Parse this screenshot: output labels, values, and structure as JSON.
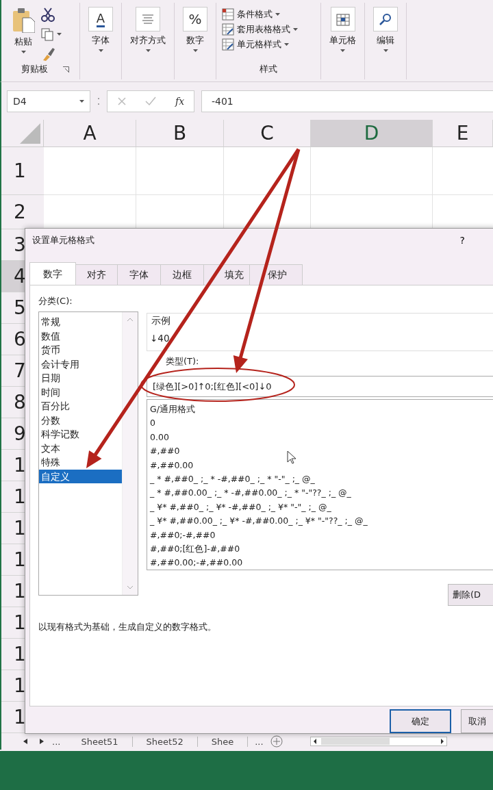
{
  "ribbon": {
    "groups": [
      {
        "kind": "clipboard",
        "label": "剪贴板",
        "paste": "粘贴"
      },
      {
        "kind": "font",
        "icon_text": "A",
        "label": "字体"
      },
      {
        "kind": "align",
        "label": "对齐方式"
      },
      {
        "kind": "number",
        "icon_text": "%",
        "label": "数字"
      },
      {
        "kind": "styles",
        "label": "样式",
        "items": [
          "条件格式",
          "套用表格格式",
          "单元格样式"
        ]
      },
      {
        "kind": "cells",
        "label": "单元格"
      },
      {
        "kind": "edit",
        "label": "编辑"
      }
    ]
  },
  "formula_bar": {
    "name_box": "D4",
    "fx": "fx",
    "value": "-401"
  },
  "grid": {
    "columns": [
      {
        "label": "A",
        "selected": false
      },
      {
        "label": "B",
        "selected": false
      },
      {
        "label": "C",
        "selected": false
      },
      {
        "label": "D",
        "selected": true
      },
      {
        "label": "E",
        "selected": false
      }
    ],
    "rows": [
      {
        "label": "1",
        "selected": false
      },
      {
        "label": "2",
        "selected": false
      },
      {
        "label": "3",
        "selected": false
      },
      {
        "label": "4",
        "selected": true
      },
      {
        "label": "5",
        "selected": false
      },
      {
        "label": "6",
        "selected": false
      },
      {
        "label": "7",
        "selected": false
      },
      {
        "label": "8",
        "selected": false
      },
      {
        "label": "9",
        "selected": false
      },
      {
        "label": "1",
        "selected": false
      },
      {
        "label": "1",
        "selected": false
      },
      {
        "label": "1",
        "selected": false
      },
      {
        "label": "1",
        "selected": false
      },
      {
        "label": "1",
        "selected": false
      },
      {
        "label": "1",
        "selected": false
      },
      {
        "label": "1",
        "selected": false
      },
      {
        "label": "1",
        "selected": false
      },
      {
        "label": "1",
        "selected": false
      }
    ]
  },
  "dialog": {
    "title": "设置单元格格式",
    "help": "?",
    "tabs": [
      {
        "label": "数字",
        "selected": true
      },
      {
        "label": "对齐",
        "selected": false
      },
      {
        "label": "字体",
        "selected": false
      },
      {
        "label": "边框",
        "selected": false
      },
      {
        "label": "填充",
        "selected": false
      },
      {
        "label": "保护",
        "selected": false
      }
    ],
    "category": {
      "label": "分类(C):",
      "items": [
        {
          "label": "常规",
          "selected": false
        },
        {
          "label": "数值",
          "selected": false
        },
        {
          "label": "货币",
          "selected": false
        },
        {
          "label": "会计专用",
          "selected": false
        },
        {
          "label": "日期",
          "selected": false
        },
        {
          "label": "时间",
          "selected": false
        },
        {
          "label": "百分比",
          "selected": false
        },
        {
          "label": "分数",
          "selected": false
        },
        {
          "label": "科学记数",
          "selected": false
        },
        {
          "label": "文本",
          "selected": false
        },
        {
          "label": "特殊",
          "selected": false
        },
        {
          "label": "自定义",
          "selected": true
        }
      ]
    },
    "sample": {
      "label": "示例",
      "value": "↓40"
    },
    "type": {
      "label": "类型(T):",
      "value": "[绿色][>0]↑0;[红色][<0]↓0"
    },
    "formats": [
      "G/通用格式",
      "0",
      "0.00",
      "#,##0",
      "#,##0.00",
      "_ * #,##0_ ;_ * -#,##0_ ;_ * \"-\"_ ;_ @_",
      "_ * #,##0.00_ ;_ * -#,##0.00_ ;_ * \"-\"??_ ;_ @_",
      "_ ¥* #,##0_ ;_ ¥* -#,##0_ ;_ ¥* \"-\"_ ;_ @_",
      "_ ¥* #,##0.00_ ;_ ¥* -#,##0.00_ ;_ ¥* \"-\"??_ ;_ @_",
      "#,##0;-#,##0",
      "#,##0;[红色]-#,##0",
      "#,##0.00;-#,##0.00"
    ],
    "delete_button": "删除(D",
    "description": "以现有格式为基础，生成自定义的数字格式。",
    "buttons": [
      {
        "label": "确定",
        "default": true
      },
      {
        "label": "取消",
        "default": false
      }
    ]
  },
  "sheet_bar": {
    "overflow": "...",
    "tabs": [
      {
        "label": "Sheet51",
        "selected": false
      },
      {
        "label": "Sheet52",
        "selected": false
      },
      {
        "label": "Shee",
        "selected": false
      }
    ],
    "more": "..."
  }
}
